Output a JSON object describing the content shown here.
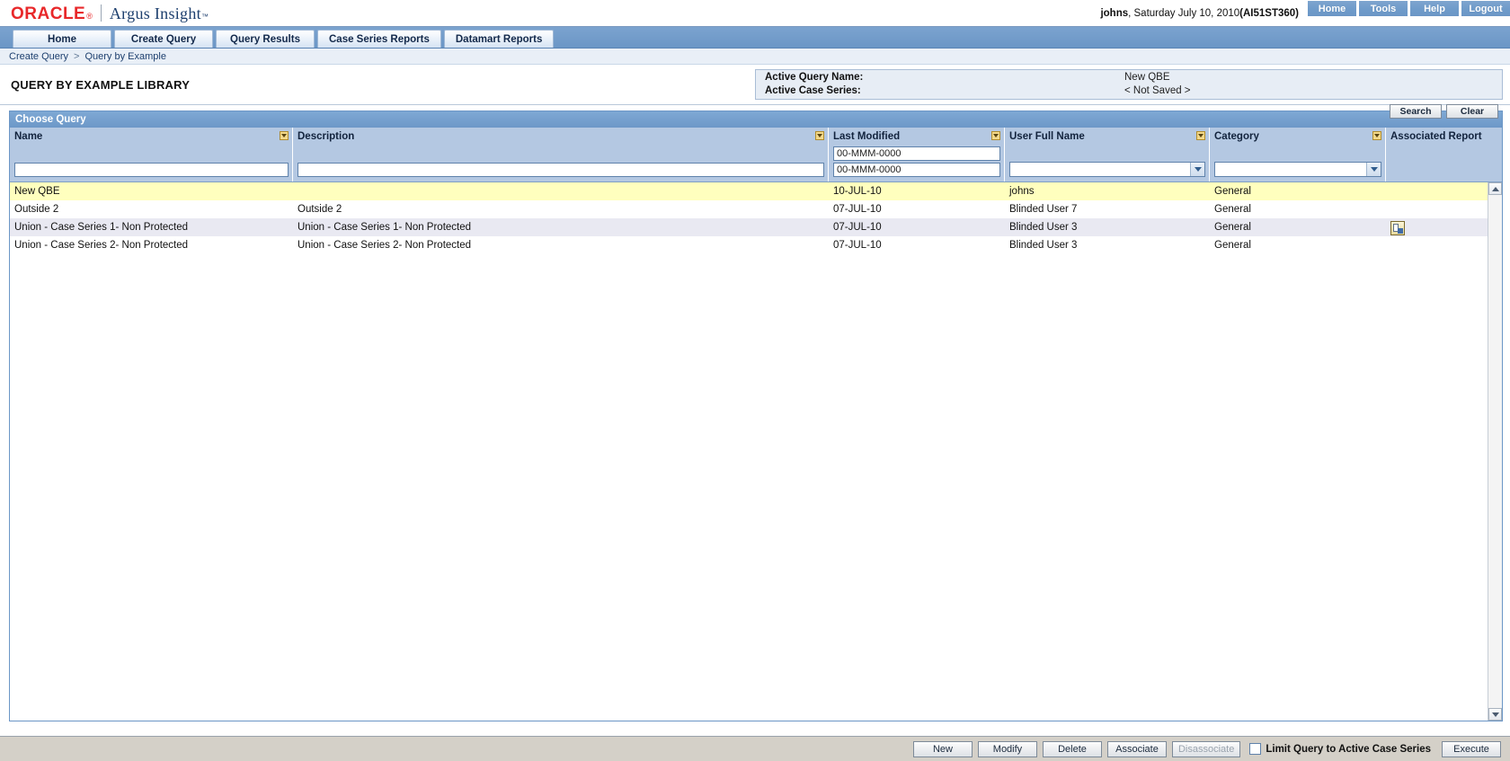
{
  "brand": {
    "oracle": "ORACLE",
    "registered": "®",
    "product": "Argus Insight",
    "trademark": "™"
  },
  "header": {
    "user_name": "johns",
    "user_meta": ", Saturday July 10, 2010 ",
    "session_id": "(AI51ST360)",
    "buttons": [
      {
        "label": "Home",
        "icon": "home-icon"
      },
      {
        "label": "Tools",
        "icon": "tools-icon"
      },
      {
        "label": "Help",
        "icon": "help-icon"
      },
      {
        "label": "Logout",
        "icon": "logout-icon"
      }
    ]
  },
  "nav": {
    "tabs": [
      {
        "label": "Home"
      },
      {
        "label": "Create Query"
      },
      {
        "label": "Query Results"
      },
      {
        "label": "Case Series Reports"
      },
      {
        "label": "Datamart Reports"
      }
    ]
  },
  "breadcrumb": {
    "first": "Create Query",
    "separator": ">",
    "second": "Query by Example"
  },
  "page": {
    "title": "QUERY BY EXAMPLE LIBRARY"
  },
  "active_panel": {
    "query_name_label": "Active Query Name:",
    "query_name_value": "New QBE",
    "case_series_label": "Active Case Series:",
    "case_series_value": "< Not Saved >"
  },
  "panel": {
    "title": "Choose Query",
    "search_label": "Search",
    "clear_label": "Clear"
  },
  "grid": {
    "columns": [
      {
        "label": "Name",
        "filter_type": "text",
        "filter_value": "",
        "sortable": true
      },
      {
        "label": "Description",
        "filter_type": "text",
        "filter_value": "",
        "sortable": true
      },
      {
        "label": "Last Modified",
        "filter_type": "date-range",
        "filter_value_from": "00-MMM-0000",
        "filter_value_to": "00-MMM-0000",
        "sortable": true
      },
      {
        "label": "User Full Name",
        "filter_type": "select",
        "filter_value": "",
        "sortable": true
      },
      {
        "label": "Category",
        "filter_type": "select",
        "filter_value": "",
        "sortable": true
      },
      {
        "label": "Associated Report",
        "filter_type": "none",
        "filter_value": "",
        "sortable": false
      }
    ],
    "rows": [
      {
        "name": "New QBE",
        "description": "",
        "last_modified": "10-JUL-10",
        "user_full_name": "johns",
        "category": "General",
        "associated_report": false,
        "selected": true
      },
      {
        "name": "Outside 2",
        "description": "Outside 2",
        "last_modified": "07-JUL-10",
        "user_full_name": "Blinded User 7",
        "category": "General",
        "associated_report": false,
        "selected": false
      },
      {
        "name": "Union - Case Series 1- Non Protected",
        "description": "Union - Case Series 1- Non Protected",
        "last_modified": "07-JUL-10",
        "user_full_name": "Blinded User 3",
        "category": "General",
        "associated_report": true,
        "selected": false
      },
      {
        "name": "Union - Case Series 2- Non Protected",
        "description": "Union - Case Series 2- Non Protected",
        "last_modified": "07-JUL-10",
        "user_full_name": "Blinded User 3",
        "category": "General",
        "associated_report": false,
        "selected": false
      }
    ]
  },
  "footer": {
    "buttons": [
      {
        "label": "New",
        "disabled": false
      },
      {
        "label": "Modify",
        "disabled": false
      },
      {
        "label": "Delete",
        "disabled": false
      },
      {
        "label": "Associate",
        "disabled": false
      },
      {
        "label": "Disassociate",
        "disabled": true
      }
    ],
    "checkbox_label": "Limit Query to Active Case Series",
    "checkbox_checked": false,
    "execute_label": "Execute"
  },
  "colors": {
    "oracle_red": "#e8282a",
    "argus_blue": "#1d3f6e",
    "nav_blue": "#6b96c6",
    "header_blue": "#b4c8e2",
    "selected_row": "#ffffbe",
    "alt_row": "#e9e9f2",
    "footer_gray": "#d4d0c8"
  }
}
